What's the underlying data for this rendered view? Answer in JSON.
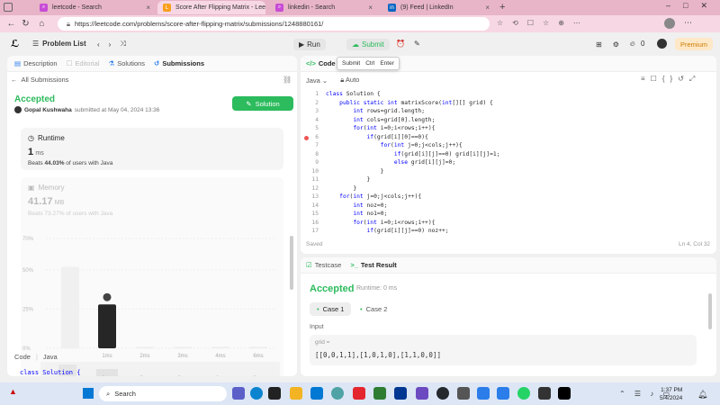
{
  "browser": {
    "tabs": [
      {
        "title": "leetcode - Search",
        "icon": "search-icon",
        "color": "#c84cd6"
      },
      {
        "title": "Score After Flipping Matrix - Lee",
        "icon": "leetcode-icon",
        "color": "#f89f1b"
      },
      {
        "title": "linkedin - Search",
        "icon": "search-icon",
        "color": "#c84cd6"
      },
      {
        "title": "(9) Feed | LinkedIn",
        "icon": "linkedin-icon",
        "color": "#0a66c2"
      }
    ],
    "new_tab": "+",
    "url": "https://leetcode.com/problems/score-after-flipping-matrix/submissions/1248880161/"
  },
  "header": {
    "problem_list": "Problem List",
    "run": "Run",
    "submit": "Submit",
    "points": "0",
    "premium": "Premium"
  },
  "left": {
    "tabs": [
      "Description",
      "Editorial",
      "Solutions",
      "Submissions"
    ],
    "all_submissions": "All Submissions",
    "status": "Accepted",
    "user": "Gopal Kushwaha",
    "submitted_at": "submitted at May 04, 2024 13:36",
    "solution_btn": "Solution",
    "runtime_label": "Runtime",
    "runtime_value": "1",
    "runtime_unit": "ms",
    "beats_runtime": "Beats",
    "beats_runtime_pct": "44.03%",
    "beats_runtime_tail": "of users with Java",
    "memory_label": "Memory",
    "memory_value": "41.17",
    "memory_unit": "MB",
    "beats_memory": "Beats 73.27% of users with Java",
    "code_label": "Code",
    "code_lang": "Java",
    "code_peek": "class Solution {"
  },
  "chart_data": {
    "type": "bar",
    "categories": [
      "1ms",
      "2ms",
      "3ms",
      "4ms",
      "6ms"
    ],
    "y_ticks": [
      "70%",
      "50%",
      "25%",
      "0%"
    ],
    "highlighted_category": "1ms",
    "ylim": [
      0,
      70
    ],
    "values": [
      28,
      1,
      1,
      1,
      1
    ],
    "prev_bar": 52,
    "xlabel": "",
    "ylabel": ""
  },
  "editor": {
    "tab_label": "Code",
    "tooltip": {
      "a": "Submit",
      "b": "Ctrl",
      "c": "Enter"
    },
    "lang": "Java",
    "auto": "Auto",
    "lines": [
      "class Solution {",
      "    public static int matrixScore(int[][] grid) {",
      "        int rows=grid.length;",
      "        int cols=grid[0].length;",
      "        for(int i=0;i<rows;i++){",
      "            if(grid[i][0]==0){",
      "                for(int j=0;j<cols;j++){",
      "                    if(grid[i][j]==0) grid[i][j]=1;",
      "                    else grid[i][j]=0;",
      "                }",
      "            }",
      "        }",
      "    for(int j=0;j<cols;j++){",
      "        int noz=0;",
      "        int no1=0;",
      "        for(int i=0;i<rows;i++){",
      "            if(grid[i][j]==0) noz++;"
    ],
    "saved": "Saved",
    "position": "Ln 4, Col 32"
  },
  "result": {
    "testcase_tab": "Testcase",
    "result_tab": "Test Result",
    "status": "Accepted",
    "runtime": "Runtime: 0 ms",
    "case1": "Case 1",
    "case2": "Case 2",
    "input_label": "Input",
    "grid_label": "grid =",
    "grid_value": "[[0,0,1,1],[1,0,1,0],[1,1,0,0]]"
  },
  "taskbar": {
    "search": "Search",
    "time": "1:37 PM",
    "date": "5/4/2024"
  }
}
